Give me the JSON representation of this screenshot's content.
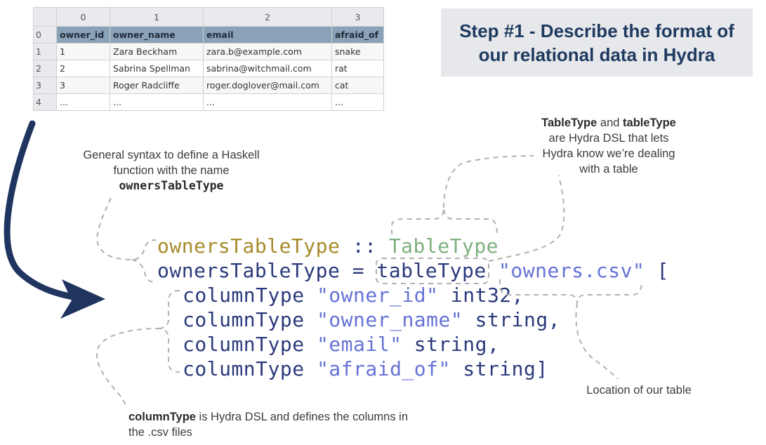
{
  "table": {
    "column_indices": [
      "0",
      "1",
      "2",
      "3"
    ],
    "row_indices": [
      "0",
      "1",
      "2",
      "3",
      "4"
    ],
    "rows": [
      [
        "owner_id",
        "owner_name",
        "email",
        "afraid_of"
      ],
      [
        "1",
        "Zara Beckham",
        "zara.b@example.com",
        "snake"
      ],
      [
        "2",
        "Sabrina Spellman",
        "sabrina@witchmail.com",
        "rat"
      ],
      [
        "3",
        "Roger Radcliffe",
        "roger.doglover@mail.com",
        "cat"
      ],
      [
        "...",
        "...",
        "...",
        "..."
      ]
    ]
  },
  "title": {
    "text": "Step #1 - Describe the format of our relational data in Hydra"
  },
  "notes": {
    "haskell": {
      "line1": "General syntax to define a Haskell",
      "line2": "function with the name",
      "name": "ownersTableType"
    },
    "hydra_dsl": {
      "bold1": "TableType",
      "and": " and ",
      "bold2": "tableType",
      "line2": "are Hydra DSL that lets",
      "line3": "Hydra know we’re dealing",
      "line4": "with a table"
    },
    "location": "Location of our table",
    "column_type": {
      "bold": "columnType",
      "rest": " is Hydra DSL and defines the columns in",
      "line2": "the .csv files"
    }
  },
  "code": {
    "line1": {
      "fn": "ownersTableType",
      "sep": " :: ",
      "type": "TableType"
    },
    "line2": {
      "fn": "ownersTableType",
      "eq": " = ",
      "call": "tableType",
      "str": "\"owners.csv\"",
      "open": " ["
    },
    "columns": [
      {
        "kw": "columnType ",
        "str": "\"owner_id\"",
        "type": " int32,"
      },
      {
        "kw": "columnType ",
        "str": "\"owner_name\"",
        "type": " string,"
      },
      {
        "kw": "columnType ",
        "str": "\"email\"",
        "type": " string,"
      },
      {
        "kw": "columnType ",
        "str": "\"afraid_of\"",
        "type": " string]"
      }
    ]
  },
  "colors": {
    "arrow": "#1f3560",
    "function_name": "#a78b2a",
    "type_name": "#7fb07f",
    "string": "#6672d6",
    "plain_code": "#2b3a7c",
    "title_text": "#1f3a5f",
    "title_bg": "#e6e8ec",
    "table_header": "#8aa2b8",
    "dashed_lines": "#b0b0b0"
  }
}
